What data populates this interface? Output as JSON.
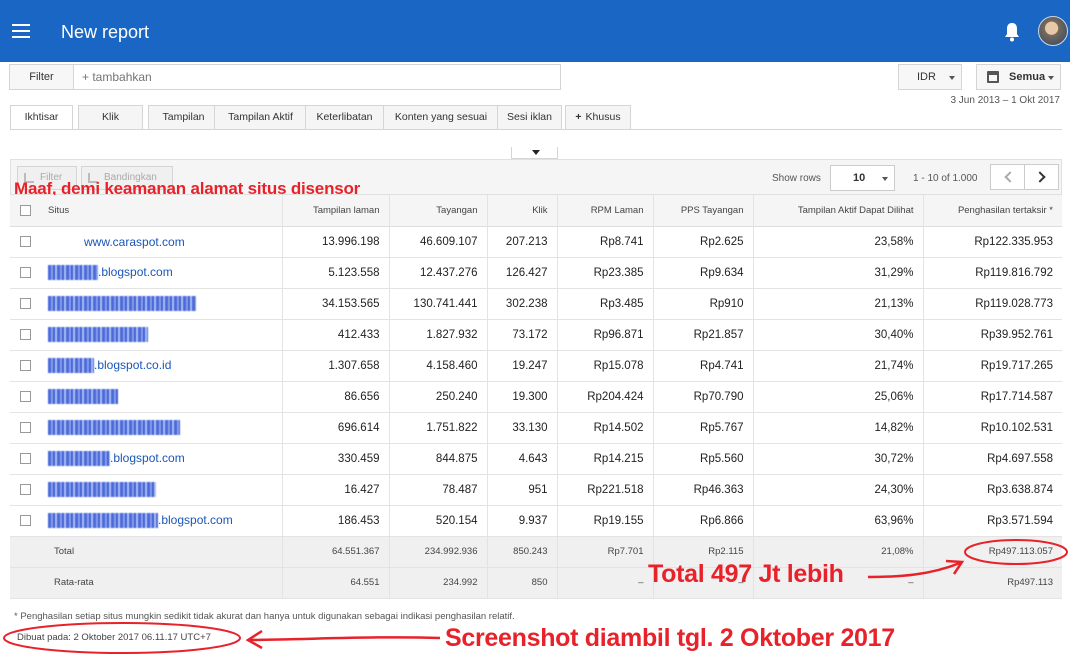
{
  "header": {
    "title": "New report"
  },
  "filter": {
    "label": "Filter",
    "placeholder": "+ tambahkan"
  },
  "currency": {
    "value": "IDR"
  },
  "date_range": {
    "label": "Semua",
    "text": "3 Jun 2013 – 1 Okt 2017"
  },
  "tabs": [
    {
      "label": "Ikhtisar",
      "active": true
    },
    {
      "label": "Klik"
    },
    {
      "label": "Tampilan"
    },
    {
      "label": "Tampilan Aktif"
    },
    {
      "label": "Keterlibatan"
    },
    {
      "label": "Konten yang sesuai"
    },
    {
      "label": "Sesi iklan"
    },
    {
      "label": "Khusus"
    }
  ],
  "toolbar": {
    "filter_label": "Filter",
    "compare_label": "Bandingkan",
    "show_rows_label": "Show rows",
    "rows_value": "10",
    "pager_text": "1 - 10 of 1.000"
  },
  "censor_note": "Maaf, demi keamanan alamat situs disensor",
  "table": {
    "columns": [
      "Situs",
      "Tampilan laman",
      "Tayangan",
      "Klik",
      "RPM Laman",
      "PPS Tayangan",
      "Tampilan Aktif Dapat Dilihat",
      "Penghasilan tertaksir *"
    ],
    "rows": [
      {
        "site": "www.caraspot.com",
        "site_prefix": "",
        "cells": [
          "13.996.198",
          "46.609.107",
          "207.213",
          "Rp8.741",
          "Rp2.625",
          "23,58%",
          "Rp122.335.953"
        ]
      },
      {
        "site": ".blogspot.com",
        "site_prefix": "blurred",
        "cells": [
          "5.123.558",
          "12.437.276",
          "126.427",
          "Rp23.385",
          "Rp9.634",
          "31,29%",
          "Rp119.816.792"
        ]
      },
      {
        "site": "",
        "site_prefix": "blurred",
        "cells": [
          "34.153.565",
          "130.741.441",
          "302.238",
          "Rp3.485",
          "Rp910",
          "21,13%",
          "Rp119.028.773"
        ]
      },
      {
        "site": "",
        "site_prefix": "blurred",
        "cells": [
          "412.433",
          "1.827.932",
          "73.172",
          "Rp96.871",
          "Rp21.857",
          "30,40%",
          "Rp39.952.761"
        ]
      },
      {
        "site": ".blogspot.co.id",
        "site_prefix": "blurred",
        "cells": [
          "1.307.658",
          "4.158.460",
          "19.247",
          "Rp15.078",
          "Rp4.741",
          "21,74%",
          "Rp19.717.265"
        ]
      },
      {
        "site": "",
        "site_prefix": "blurred",
        "cells": [
          "86.656",
          "250.240",
          "19.300",
          "Rp204.424",
          "Rp70.790",
          "25,06%",
          "Rp17.714.587"
        ]
      },
      {
        "site": "",
        "site_prefix": "blurred",
        "cells": [
          "696.614",
          "1.751.822",
          "33.130",
          "Rp14.502",
          "Rp5.767",
          "14,82%",
          "Rp10.102.531"
        ]
      },
      {
        "site": ".blogspot.com",
        "site_prefix": "blurred",
        "cells": [
          "330.459",
          "844.875",
          "4.643",
          "Rp14.215",
          "Rp5.560",
          "30,72%",
          "Rp4.697.558"
        ]
      },
      {
        "site": "",
        "site_prefix": "blurred",
        "cells": [
          "16.427",
          "78.487",
          "951",
          "Rp221.518",
          "Rp46.363",
          "24,30%",
          "Rp3.638.874"
        ]
      },
      {
        "site": ".blogspot.com",
        "site_prefix": "blurred",
        "cells": [
          "186.453",
          "520.154",
          "9.937",
          "Rp19.155",
          "Rp6.866",
          "63,96%",
          "Rp3.571.594"
        ]
      }
    ],
    "total": {
      "label": "Total",
      "cells": [
        "64.551.367",
        "234.992.936",
        "850.243",
        "Rp7.701",
        "Rp2.115",
        "21,08%",
        "Rp497.113.057"
      ]
    },
    "average": {
      "label": "Rata-rata",
      "cells": [
        "64.551",
        "234.992",
        "850",
        "–",
        "–",
        "–",
        "Rp497.113"
      ]
    }
  },
  "footnote": "* Penghasilan setiap situs mungkin sedikit tidak akurat dan hanya untuk digunakan sebagai indikasi penghasilan relatif.",
  "created_at": "Dibuat pada: 2 Oktober 2017 06.11.17 UTC+7",
  "annotations": {
    "total_note": "Total 497 Jt lebih",
    "screenshot_note": "Screenshot diambil tgl. 2 Oktober 2017"
  },
  "colors": {
    "header_bg": "#1a66c4",
    "link": "#1a56b8",
    "annotation": "#e8222a"
  }
}
